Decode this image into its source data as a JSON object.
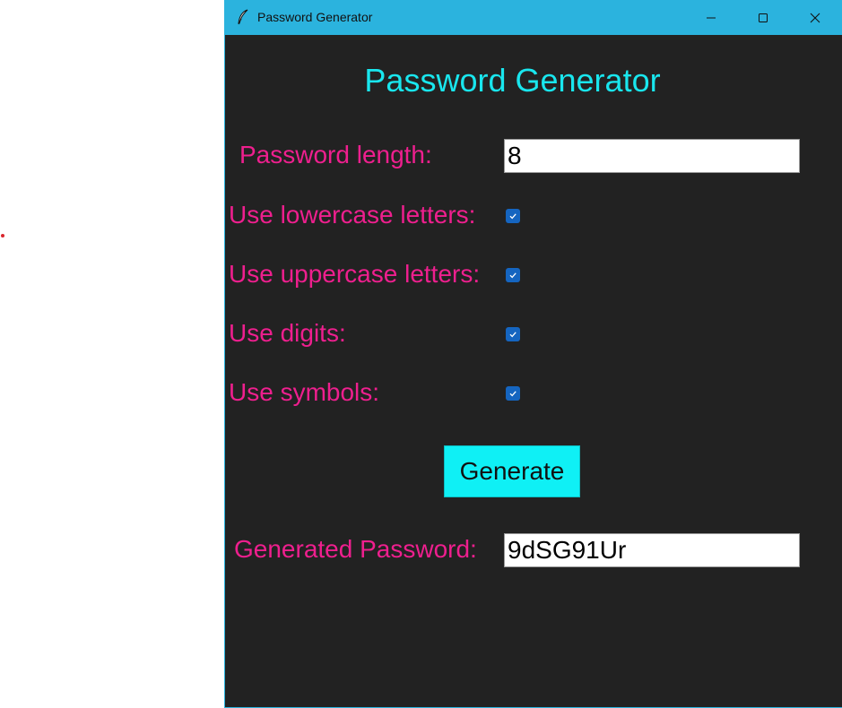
{
  "window": {
    "title": "Password Generator"
  },
  "titlebar_icons": {
    "app": "feather-icon",
    "minimize": "minimize-icon",
    "maximize": "maximize-icon",
    "close": "close-icon"
  },
  "app": {
    "heading": "Password Generator",
    "length_label": "Password length:",
    "length_value": "8",
    "options": [
      {
        "label": "Use lowercase letters:",
        "checked": true
      },
      {
        "label": "Use uppercase letters:",
        "checked": true
      },
      {
        "label": "Use digits:",
        "checked": true
      },
      {
        "label": "Use symbols:",
        "checked": true
      }
    ],
    "generate_label": "Generate",
    "result_label": "Generated Password:",
    "result_value": "9dSG91Ur"
  },
  "colors": {
    "titlebar": "#2bb3de",
    "background": "#222222",
    "heading": "#19e6ee",
    "label": "#ee1f8e",
    "button": "#0ff0f5",
    "checkbox": "#1565c0"
  }
}
